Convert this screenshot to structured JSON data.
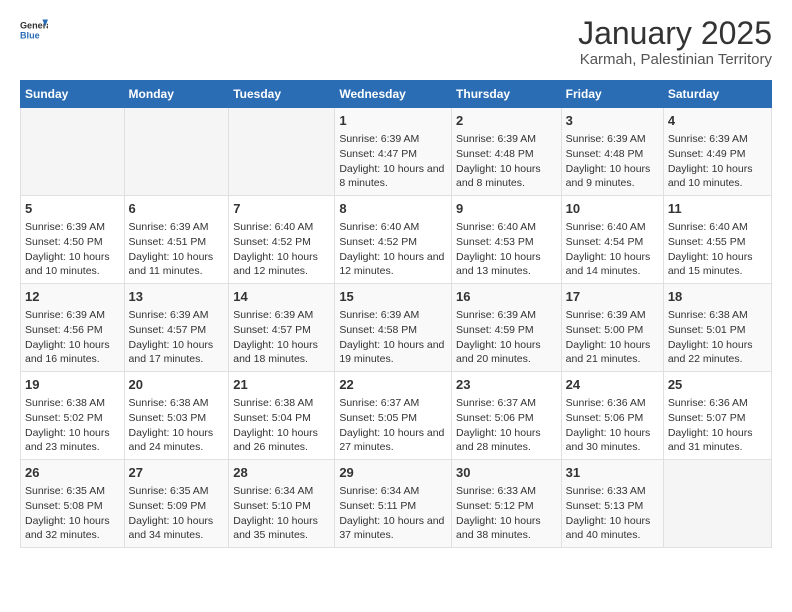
{
  "header": {
    "logo_general": "General",
    "logo_blue": "Blue",
    "title": "January 2025",
    "subtitle": "Karmah, Palestinian Territory"
  },
  "weekdays": [
    "Sunday",
    "Monday",
    "Tuesday",
    "Wednesday",
    "Thursday",
    "Friday",
    "Saturday"
  ],
  "weeks": [
    [
      {
        "day": "",
        "empty": true
      },
      {
        "day": "",
        "empty": true
      },
      {
        "day": "",
        "empty": true
      },
      {
        "day": "1",
        "sunrise": "6:39 AM",
        "sunset": "4:47 PM",
        "daylight": "10 hours and 8 minutes."
      },
      {
        "day": "2",
        "sunrise": "6:39 AM",
        "sunset": "4:48 PM",
        "daylight": "10 hours and 8 minutes."
      },
      {
        "day": "3",
        "sunrise": "6:39 AM",
        "sunset": "4:48 PM",
        "daylight": "10 hours and 9 minutes."
      },
      {
        "day": "4",
        "sunrise": "6:39 AM",
        "sunset": "4:49 PM",
        "daylight": "10 hours and 10 minutes."
      }
    ],
    [
      {
        "day": "5",
        "sunrise": "6:39 AM",
        "sunset": "4:50 PM",
        "daylight": "10 hours and 10 minutes."
      },
      {
        "day": "6",
        "sunrise": "6:39 AM",
        "sunset": "4:51 PM",
        "daylight": "10 hours and 11 minutes."
      },
      {
        "day": "7",
        "sunrise": "6:40 AM",
        "sunset": "4:52 PM",
        "daylight": "10 hours and 12 minutes."
      },
      {
        "day": "8",
        "sunrise": "6:40 AM",
        "sunset": "4:52 PM",
        "daylight": "10 hours and 12 minutes."
      },
      {
        "day": "9",
        "sunrise": "6:40 AM",
        "sunset": "4:53 PM",
        "daylight": "10 hours and 13 minutes."
      },
      {
        "day": "10",
        "sunrise": "6:40 AM",
        "sunset": "4:54 PM",
        "daylight": "10 hours and 14 minutes."
      },
      {
        "day": "11",
        "sunrise": "6:40 AM",
        "sunset": "4:55 PM",
        "daylight": "10 hours and 15 minutes."
      }
    ],
    [
      {
        "day": "12",
        "sunrise": "6:39 AM",
        "sunset": "4:56 PM",
        "daylight": "10 hours and 16 minutes."
      },
      {
        "day": "13",
        "sunrise": "6:39 AM",
        "sunset": "4:57 PM",
        "daylight": "10 hours and 17 minutes."
      },
      {
        "day": "14",
        "sunrise": "6:39 AM",
        "sunset": "4:57 PM",
        "daylight": "10 hours and 18 minutes."
      },
      {
        "day": "15",
        "sunrise": "6:39 AM",
        "sunset": "4:58 PM",
        "daylight": "10 hours and 19 minutes."
      },
      {
        "day": "16",
        "sunrise": "6:39 AM",
        "sunset": "4:59 PM",
        "daylight": "10 hours and 20 minutes."
      },
      {
        "day": "17",
        "sunrise": "6:39 AM",
        "sunset": "5:00 PM",
        "daylight": "10 hours and 21 minutes."
      },
      {
        "day": "18",
        "sunrise": "6:38 AM",
        "sunset": "5:01 PM",
        "daylight": "10 hours and 22 minutes."
      }
    ],
    [
      {
        "day": "19",
        "sunrise": "6:38 AM",
        "sunset": "5:02 PM",
        "daylight": "10 hours and 23 minutes."
      },
      {
        "day": "20",
        "sunrise": "6:38 AM",
        "sunset": "5:03 PM",
        "daylight": "10 hours and 24 minutes."
      },
      {
        "day": "21",
        "sunrise": "6:38 AM",
        "sunset": "5:04 PM",
        "daylight": "10 hours and 26 minutes."
      },
      {
        "day": "22",
        "sunrise": "6:37 AM",
        "sunset": "5:05 PM",
        "daylight": "10 hours and 27 minutes."
      },
      {
        "day": "23",
        "sunrise": "6:37 AM",
        "sunset": "5:06 PM",
        "daylight": "10 hours and 28 minutes."
      },
      {
        "day": "24",
        "sunrise": "6:36 AM",
        "sunset": "5:06 PM",
        "daylight": "10 hours and 30 minutes."
      },
      {
        "day": "25",
        "sunrise": "6:36 AM",
        "sunset": "5:07 PM",
        "daylight": "10 hours and 31 minutes."
      }
    ],
    [
      {
        "day": "26",
        "sunrise": "6:35 AM",
        "sunset": "5:08 PM",
        "daylight": "10 hours and 32 minutes."
      },
      {
        "day": "27",
        "sunrise": "6:35 AM",
        "sunset": "5:09 PM",
        "daylight": "10 hours and 34 minutes."
      },
      {
        "day": "28",
        "sunrise": "6:34 AM",
        "sunset": "5:10 PM",
        "daylight": "10 hours and 35 minutes."
      },
      {
        "day": "29",
        "sunrise": "6:34 AM",
        "sunset": "5:11 PM",
        "daylight": "10 hours and 37 minutes."
      },
      {
        "day": "30",
        "sunrise": "6:33 AM",
        "sunset": "5:12 PM",
        "daylight": "10 hours and 38 minutes."
      },
      {
        "day": "31",
        "sunrise": "6:33 AM",
        "sunset": "5:13 PM",
        "daylight": "10 hours and 40 minutes."
      },
      {
        "day": "",
        "empty": true
      }
    ]
  ]
}
